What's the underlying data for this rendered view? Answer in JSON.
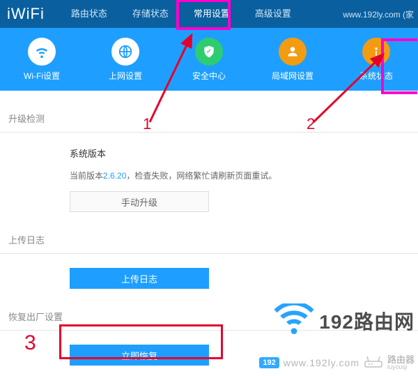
{
  "topnav": {
    "logo": "iWiFi",
    "tabs": [
      "路由状态",
      "存储状态",
      "常用设置",
      "高级设置"
    ],
    "active_index": 2,
    "url_text": "www.192ly.com (家"
  },
  "iconrow": [
    {
      "label": "Wi-Fi设置",
      "icon": "wifi-icon",
      "color": "white"
    },
    {
      "label": "上网设置",
      "icon": "globe-icon",
      "color": "white"
    },
    {
      "label": "安全中心",
      "icon": "shield-icon",
      "color": "green"
    },
    {
      "label": "局域网设置",
      "icon": "user-icon",
      "color": "orange"
    },
    {
      "label": "系统状态",
      "icon": "info-icon",
      "color": "orange"
    }
  ],
  "sections": {
    "upgrade": {
      "title": "升级检测",
      "version_label": "系统版本",
      "version_prefix": "当前版本",
      "version_number": "2.6.20",
      "version_suffix": "，检查失败，网络繁忙请刷新页面重试。",
      "manual_btn": "手动升级"
    },
    "log": {
      "title": "上传日志",
      "btn": "上传日志"
    },
    "restore": {
      "title": "恢复出厂设置",
      "btn": "立即恢复"
    }
  },
  "annotations": {
    "n1": "1",
    "n2": "2",
    "n3": "3"
  },
  "watermarks": {
    "wm1_text": "192路由网",
    "wm2_badge": "192",
    "wm2_url": "www.192ly.com",
    "wm2_label": "路由器",
    "wm2_sub": "luyouqi"
  }
}
